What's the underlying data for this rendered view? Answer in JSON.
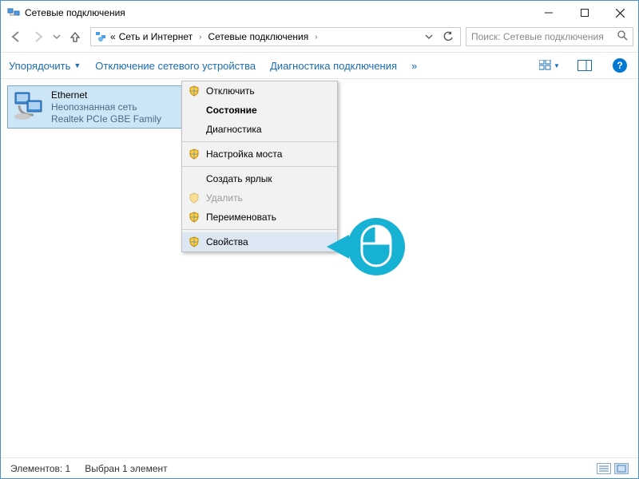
{
  "window": {
    "title": "Сетевые подключения"
  },
  "breadcrumb": {
    "prefix": "«",
    "seg1": "Сеть и Интернет",
    "seg2": "Сетевые подключения"
  },
  "search": {
    "placeholder": "Поиск: Сетевые подключения"
  },
  "commands": {
    "organize": "Упорядочить",
    "disable_device": "Отключение сетевого устройства",
    "diagnose": "Диагностика подключения",
    "more": "»"
  },
  "adapter": {
    "name": "Ethernet",
    "status": "Неопознанная сеть",
    "device": "Realtek PCIe GBE Family"
  },
  "context_menu": {
    "disable": "Отключить",
    "status": "Состояние",
    "diagnose": "Диагностика",
    "bridge": "Настройка моста",
    "shortcut": "Создать ярлык",
    "delete": "Удалить",
    "rename": "Переименовать",
    "properties": "Свойства"
  },
  "statusbar": {
    "items": "Элементов: 1",
    "selected": "Выбран 1 элемент"
  }
}
